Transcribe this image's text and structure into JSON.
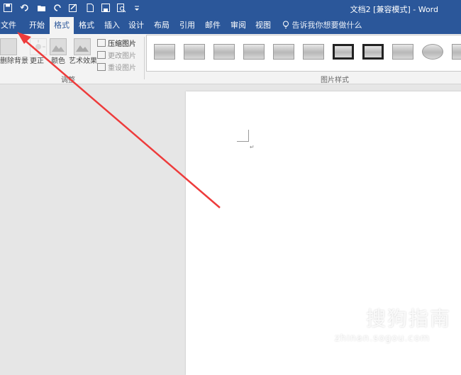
{
  "titlebar": {
    "document_title": "文档2 [兼容模式] - Word",
    "quick_access": [
      "save-icon",
      "undo-icon",
      "open-icon",
      "redo-icon",
      "edit-icon",
      "new-icon",
      "print-preview-icon",
      "zoom-icon",
      "more-icon"
    ]
  },
  "tabs": [
    {
      "label": "文件",
      "active": false
    },
    {
      "label": "开始",
      "active": false
    },
    {
      "label": "格式",
      "active": true
    },
    {
      "label": "格式",
      "active": false
    },
    {
      "label": "插入",
      "active": false
    },
    {
      "label": "设计",
      "active": false
    },
    {
      "label": "布局",
      "active": false
    },
    {
      "label": "引用",
      "active": false
    },
    {
      "label": "邮件",
      "active": false
    },
    {
      "label": "审阅",
      "active": false
    },
    {
      "label": "视图",
      "active": false
    }
  ],
  "tell_me": "告诉我你想要做什么",
  "ribbon": {
    "remove_background": "删除背景",
    "corrections": "更正",
    "color": "颜色",
    "artistic_effects": "艺术效果",
    "compress_pictures": "压缩图片",
    "change_picture": "更改图片",
    "reset_picture": "重设图片",
    "adjust_group": "调整",
    "picture_styles_group": "图片样式"
  },
  "watermark": {
    "name": "搜狗指南",
    "url": "zhinan.sogou.com"
  },
  "colors": {
    "accent": "#2b579a",
    "arrow": "#ee3b3b"
  }
}
